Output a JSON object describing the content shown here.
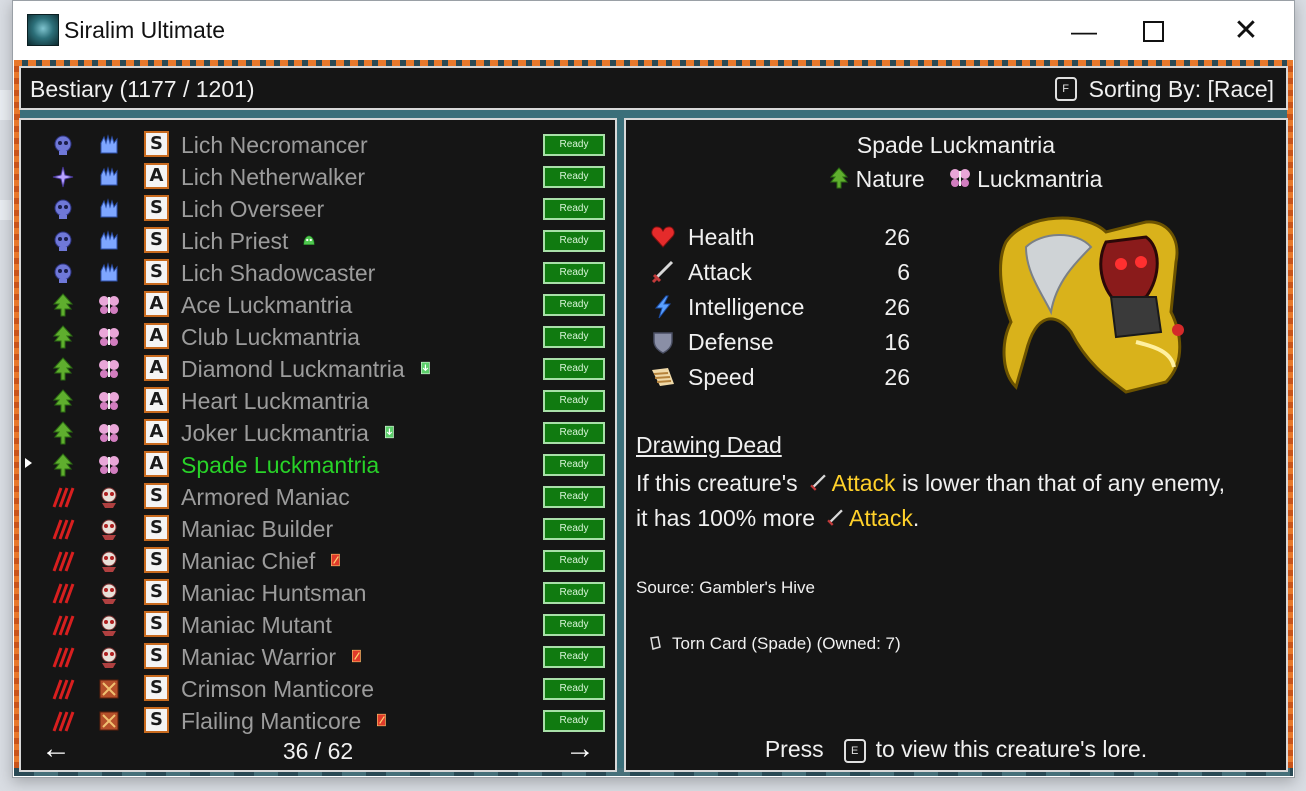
{
  "window": {
    "title": "Siralim Ultimate",
    "minimize": "—",
    "close": "✕"
  },
  "header": {
    "title": "Bestiary (1177 / 1201)",
    "sort_key": "F",
    "sort_label": "Sorting By: [Race]"
  },
  "list": {
    "status_label": "Ready",
    "page": "36 / 62",
    "prev_arrow": "←",
    "next_arrow": "→",
    "rows": [
      {
        "name": "Lich Necromancer",
        "rarity": "S",
        "race_icon": "lich-skull-icon",
        "class_icon": "death-hand-icon",
        "marker": ""
      },
      {
        "name": "Lich Netherwalker",
        "rarity": "A",
        "race_icon": "sorcery-star-icon",
        "class_icon": "death-hand-icon",
        "marker": ""
      },
      {
        "name": "Lich Overseer",
        "rarity": "S",
        "race_icon": "lich-skull-icon",
        "class_icon": "death-hand-icon",
        "marker": ""
      },
      {
        "name": "Lich Priest",
        "rarity": "S",
        "race_icon": "lich-skull-icon",
        "class_icon": "death-hand-icon",
        "marker": "slime-icon"
      },
      {
        "name": "Lich Shadowcaster",
        "rarity": "S",
        "race_icon": "lich-skull-icon",
        "class_icon": "death-hand-icon",
        "marker": ""
      },
      {
        "name": "Ace Luckmantria",
        "rarity": "A",
        "race_icon": "nature-leaf-icon",
        "class_icon": "luckmantria-butterfly-icon",
        "marker": ""
      },
      {
        "name": "Club Luckmantria",
        "rarity": "A",
        "race_icon": "nature-leaf-icon",
        "class_icon": "luckmantria-butterfly-icon",
        "marker": ""
      },
      {
        "name": "Diamond Luckmantria",
        "rarity": "A",
        "race_icon": "nature-leaf-icon",
        "class_icon": "luckmantria-butterfly-icon",
        "marker": "green-card-icon"
      },
      {
        "name": "Heart Luckmantria",
        "rarity": "A",
        "race_icon": "nature-leaf-icon",
        "class_icon": "luckmantria-butterfly-icon",
        "marker": ""
      },
      {
        "name": "Joker Luckmantria",
        "rarity": "A",
        "race_icon": "nature-leaf-icon",
        "class_icon": "luckmantria-butterfly-icon",
        "marker": "green-card-icon"
      },
      {
        "name": "Spade Luckmantria",
        "rarity": "A",
        "race_icon": "nature-leaf-icon",
        "class_icon": "luckmantria-butterfly-icon",
        "marker": "",
        "selected": true
      },
      {
        "name": "Armored Maniac",
        "rarity": "S",
        "race_icon": "chaos-claw-icon",
        "class_icon": "maniac-skull-icon",
        "marker": ""
      },
      {
        "name": "Maniac Builder",
        "rarity": "S",
        "race_icon": "chaos-claw-icon",
        "class_icon": "maniac-skull-icon",
        "marker": ""
      },
      {
        "name": "Maniac Chief",
        "rarity": "S",
        "race_icon": "chaos-claw-icon",
        "class_icon": "maniac-skull-icon",
        "marker": "red-card-icon"
      },
      {
        "name": "Maniac Huntsman",
        "rarity": "S",
        "race_icon": "chaos-claw-icon",
        "class_icon": "maniac-skull-icon",
        "marker": ""
      },
      {
        "name": "Maniac Mutant",
        "rarity": "S",
        "race_icon": "chaos-claw-icon",
        "class_icon": "maniac-skull-icon",
        "marker": ""
      },
      {
        "name": "Maniac Warrior",
        "rarity": "S",
        "race_icon": "chaos-claw-icon",
        "class_icon": "maniac-skull-icon",
        "marker": "red-card-icon"
      },
      {
        "name": "Crimson Manticore",
        "rarity": "S",
        "race_icon": "chaos-claw-icon",
        "class_icon": "manticore-icon",
        "marker": ""
      },
      {
        "name": "Flailing Manticore",
        "rarity": "S",
        "race_icon": "chaos-claw-icon",
        "class_icon": "manticore-icon",
        "marker": "red-card-icon"
      }
    ]
  },
  "detail": {
    "name": "Spade Luckmantria",
    "class_name": "Nature",
    "race_name": "Luckmantria",
    "stats": [
      {
        "label": "Health",
        "value": "26",
        "icon": "heart-icon"
      },
      {
        "label": "Attack",
        "value": "6",
        "icon": "sword-icon"
      },
      {
        "label": "Intelligence",
        "value": "26",
        "icon": "lightning-icon"
      },
      {
        "label": "Defense",
        "value": "16",
        "icon": "shield-icon"
      },
      {
        "label": "Speed",
        "value": "26",
        "icon": "wing-icon"
      }
    ],
    "trait_name": "Drawing Dead",
    "trait_part1": "If this creature's",
    "trait_highlight1": "Attack",
    "trait_part2": "is lower than that of any enemy,",
    "trait_part3": "it has 100% more",
    "trait_highlight2": "Attack",
    "trait_part4": ".",
    "source": "Source: Gambler's Hive",
    "material": "Torn Card (Spade) (Owned: 7)",
    "lore_prefix": "Press",
    "lore_key": "E",
    "lore_suffix": "to view this creature's lore."
  },
  "colors": {
    "selected_name": "#28d228",
    "name": "#9c9c9c",
    "highlight": "#ffd12a",
    "ready_bg": "#107a10",
    "panel_bg": "#151515"
  }
}
